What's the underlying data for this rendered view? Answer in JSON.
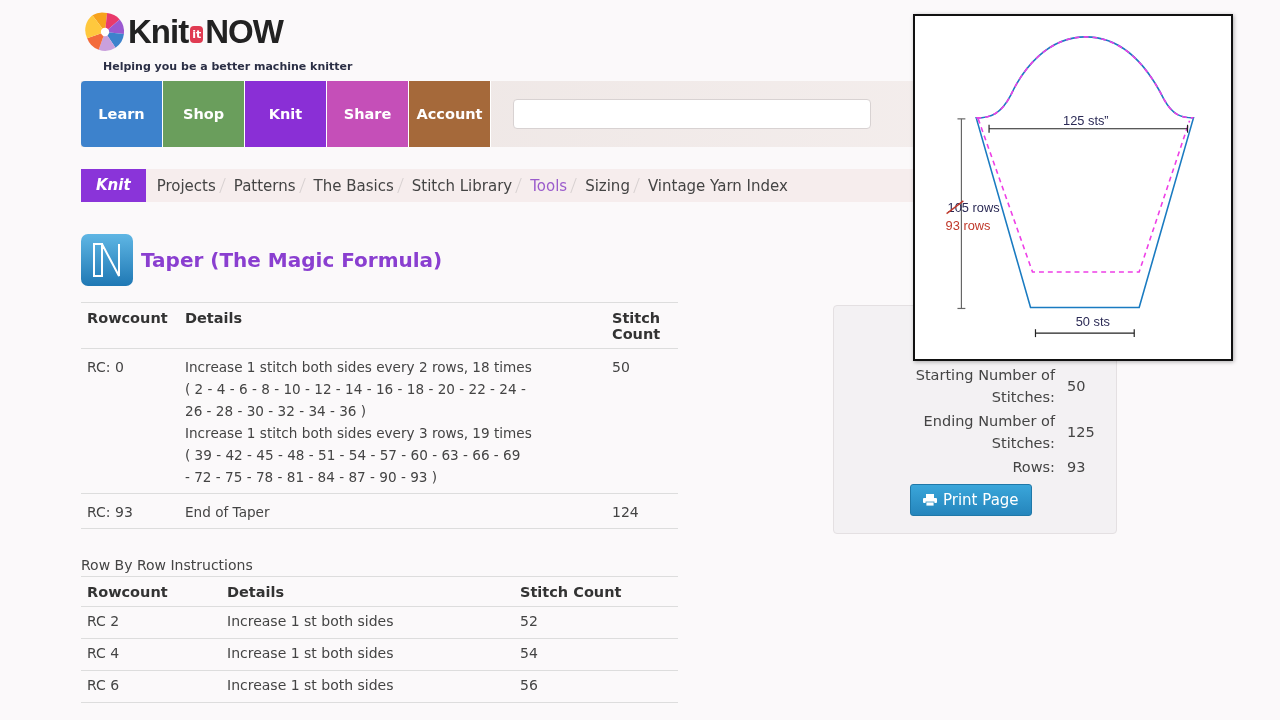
{
  "logo": {
    "part_1": "Knit",
    "badge": "it",
    "part_2": "NOW",
    "tagline": "Helping you be a better machine knitter"
  },
  "nav": [
    {
      "label": "Learn",
      "color": "#3d82cc"
    },
    {
      "label": "Shop",
      "color": "#6a9e5c"
    },
    {
      "label": "Knit",
      "color": "#8a2fd6"
    },
    {
      "label": "Share",
      "color": "#c54fb8"
    },
    {
      "label": "Account",
      "color": "#a5693a"
    }
  ],
  "breadcrumb": {
    "section": "Knit",
    "items": [
      {
        "label": "Projects",
        "selected": false
      },
      {
        "label": "Patterns",
        "selected": false
      },
      {
        "label": "The Basics",
        "selected": false
      },
      {
        "label": "Stitch Library",
        "selected": false
      },
      {
        "label": "Tools",
        "selected": true
      },
      {
        "label": "Sizing",
        "selected": false
      },
      {
        "label": "Vintage Yarn Index",
        "selected": false
      }
    ]
  },
  "title": "Taper (The Magic Formula)",
  "taper_table": {
    "columns": [
      "Rowcount",
      "Details",
      "Stitch Count"
    ],
    "rows": [
      {
        "rowcount": "RC: 0",
        "details": [
          "Increase 1 stitch both sides every 2 rows, 18 times",
          "( 2 - 4 - 6 - 8 - 10 - 12 - 14 - 16 - 18 - 20 - 22 - 24 -",
          "26 - 28 - 30 - 32 - 34 - 36 )",
          "Increase 1 stitch both sides every 3 rows, 19 times",
          "( 39 - 42 - 45 - 48 - 51 - 54 - 57 - 60 - 63 - 66 - 69",
          "- 72 - 75 - 78 - 81 - 84 - 87 - 90 - 93 )"
        ],
        "stitch_count": "50"
      },
      {
        "rowcount": "RC: 93",
        "details": [
          "End of Taper"
        ],
        "stitch_count": "124"
      }
    ]
  },
  "row_table": {
    "caption": "Row By Row Instructions",
    "columns": [
      "Rowcount",
      "Details",
      "Stitch Count"
    ],
    "rows": [
      {
        "rowcount": "RC 2",
        "details": "Increase 1 st both sides",
        "stitch_count": "52"
      },
      {
        "rowcount": "RC 4",
        "details": "Increase 1 st both sides",
        "stitch_count": "54"
      },
      {
        "rowcount": "RC 6",
        "details": "Increase 1 st both sides",
        "stitch_count": "56"
      }
    ]
  },
  "summary": {
    "rows": [
      {
        "label": "Starting Number of Stitches:",
        "value": "50"
      },
      {
        "label": "Ending Number of Stitches:",
        "value": "125"
      },
      {
        "label": "Rows:",
        "value": "93"
      }
    ],
    "button": "Print Page"
  },
  "diagram": {
    "top_width": "125 sts”",
    "old_rows": {
      "text": "105 rows",
      "struck": true
    },
    "new_rows": "93 rows",
    "bottom_width": "50 sts"
  }
}
